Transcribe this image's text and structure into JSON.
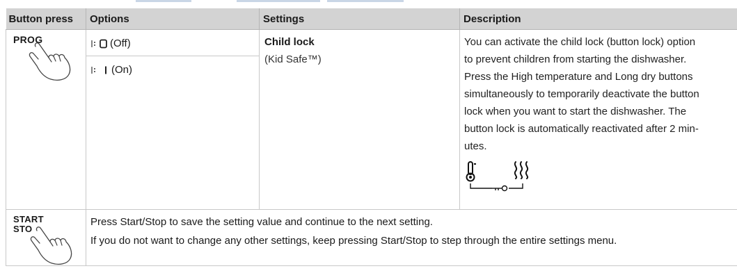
{
  "table": {
    "headers": {
      "button_press": "Button press",
      "options": "Options",
      "settings": "Settings",
      "description": "Description"
    },
    "rows": [
      {
        "button": "PROG",
        "options": [
          {
            "text": "(Off)"
          },
          {
            "text": "(On)"
          }
        ],
        "setting_title": "Child lock",
        "setting_sub": "(Kid Safe™)",
        "description": [
          "You can activate the child lock (button lock) option",
          "to prevent children from starting the dishwasher.",
          "Press the High temperature and Long dry buttons",
          "simultaneously to temporarily deactivate the button",
          "lock when you want to start the dishwasher. The",
          "button lock is automatically reactivated after 2 min-",
          "utes."
        ]
      },
      {
        "button_line1": "START",
        "button_line2": "STOP",
        "lines": [
          "Press Start/Stop to save the setting value and continue to the next setting.",
          "If you do not want to change any other settings, keep pressing Start/Stop to step through the entire settings menu."
        ]
      }
    ]
  }
}
